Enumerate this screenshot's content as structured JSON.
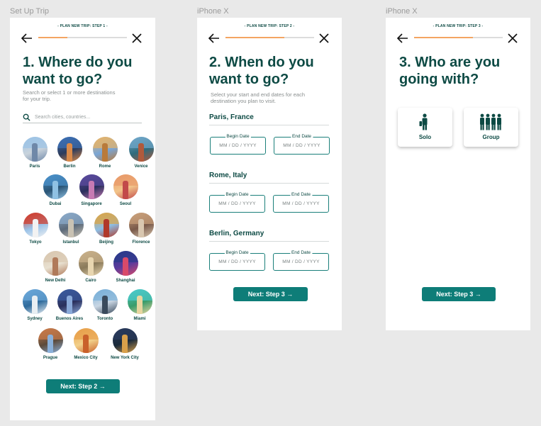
{
  "frames": [
    {
      "label": "Set Up Trip",
      "step_caption": "- PLAN NEW TRIP: STEP 1 -",
      "progress": 0.33,
      "title_line1": "1. Where do you",
      "title_line2": "want to go?",
      "subtitle_line1": "Search or select 1 or more destinations",
      "subtitle_line2": "for your trip.",
      "search_placeholder": "Search cities, countries...",
      "cities": [
        {
          "name": "Paris",
          "colors": [
            "#9cc3e6",
            "#6f88a8",
            "#c9d3dc"
          ]
        },
        {
          "name": "Berlin",
          "colors": [
            "#3c6fb3",
            "#d98a4a",
            "#2d3c5c"
          ]
        },
        {
          "name": "Rome",
          "colors": [
            "#e6b46a",
            "#b97a3a",
            "#7aa6d6"
          ]
        },
        {
          "name": "Venice",
          "colors": [
            "#6fa6c9",
            "#b05a3c",
            "#2f6b7c"
          ]
        },
        {
          "name": "Dubai",
          "colors": [
            "#4a90c9",
            "#8fc1e3",
            "#2a5576"
          ]
        },
        {
          "name": "Singapore",
          "colors": [
            "#5a4a9c",
            "#c77ab3",
            "#2a2f5c"
          ]
        },
        {
          "name": "Seoul",
          "colors": [
            "#e89a6a",
            "#c24a4a",
            "#f2c48a"
          ]
        },
        {
          "name": "Tokyo",
          "colors": [
            "#d23a2a",
            "#f2f2f2",
            "#9bc3e8"
          ]
        },
        {
          "name": "Istanbul",
          "colors": [
            "#8aa9c9",
            "#c9c2b3",
            "#5c6a7a"
          ]
        },
        {
          "name": "Beijing",
          "colors": [
            "#d9a54a",
            "#b0392a",
            "#8dbde3"
          ]
        },
        {
          "name": "Florence",
          "colors": [
            "#c9a07a",
            "#d9c7b0",
            "#7a5a4a"
          ]
        },
        {
          "name": "New Delhi",
          "colors": [
            "#d9c7b0",
            "#b07a5a",
            "#e8e0d0"
          ]
        },
        {
          "name": "Cairo",
          "colors": [
            "#c9b08a",
            "#e8d6b0",
            "#8a7a5a"
          ]
        },
        {
          "name": "Shanghai",
          "colors": [
            "#2a3a8a",
            "#d94a6a",
            "#5a3a9c"
          ]
        },
        {
          "name": "Sydney",
          "colors": [
            "#6aa6d9",
            "#e8eef2",
            "#2f6b9c"
          ]
        },
        {
          "name": "Buenos Aires",
          "colors": [
            "#3a5a9c",
            "#8aa9d9",
            "#2a2f5c"
          ]
        },
        {
          "name": "Toronto",
          "colors": [
            "#7ab0d9",
            "#3a4a5c",
            "#c9d6e3"
          ]
        },
        {
          "name": "Miami",
          "colors": [
            "#4ac9c9",
            "#e8d6a0",
            "#3a9c6a"
          ]
        },
        {
          "name": "Prague",
          "colors": [
            "#c97a4a",
            "#8ab0d9",
            "#5c4a3a"
          ]
        },
        {
          "name": "Mexico City",
          "colors": [
            "#e8a04a",
            "#c9602a",
            "#f2d08a"
          ]
        },
        {
          "name": "New York City",
          "colors": [
            "#2a3a5c",
            "#d9a04a",
            "#1a2a3a"
          ]
        }
      ],
      "button": "Next: Step 2 →"
    },
    {
      "label": "iPhone X",
      "step_caption": "- PLAN NEW TRIP: STEP 2 -",
      "progress": 0.66,
      "title_line1": "2. When do you",
      "title_line2": "want to go?",
      "subtitle_line1": "Select your start and end dates for each",
      "subtitle_line2": "destination you plan to visit.",
      "destinations": [
        {
          "name": "Paris, France",
          "begin_label": "Begin Date",
          "end_label": "End Date",
          "begin_placeholder": "MM / DD / YYYY",
          "end_placeholder": "MM / DD / YYYY"
        },
        {
          "name": "Rome, Italy",
          "begin_label": "Begin Date",
          "end_label": "End Date",
          "begin_placeholder": "MM / DD / YYYY",
          "end_placeholder": "MM / DD / YYYY"
        },
        {
          "name": "Berlin, Germany",
          "begin_label": "Begin Date",
          "end_label": "End Date",
          "begin_placeholder": "MM / DD / YYYY",
          "end_placeholder": "MM / DD / YYYY"
        }
      ],
      "button": "Next: Step 3 →"
    },
    {
      "label": "iPhone X",
      "step_caption": "- PLAN NEW TRIP: STEP 3 -",
      "progress": 0.66,
      "title_line1": "3. Who are you",
      "title_line2": "going with?",
      "options": [
        {
          "label": "Solo",
          "icon": "solo-traveler-icon"
        },
        {
          "label": "Group",
          "icon": "group-travelers-icon"
        }
      ],
      "button": "Next: Step 3 →"
    }
  ],
  "colors": {
    "brand": "#0e7d78",
    "heading": "#0d4a44",
    "progress_fill": "#f4a562",
    "progress_track": "#dcdcdc"
  },
  "icons": {
    "back": "arrow-left-icon",
    "close": "close-icon",
    "search": "search-icon"
  }
}
